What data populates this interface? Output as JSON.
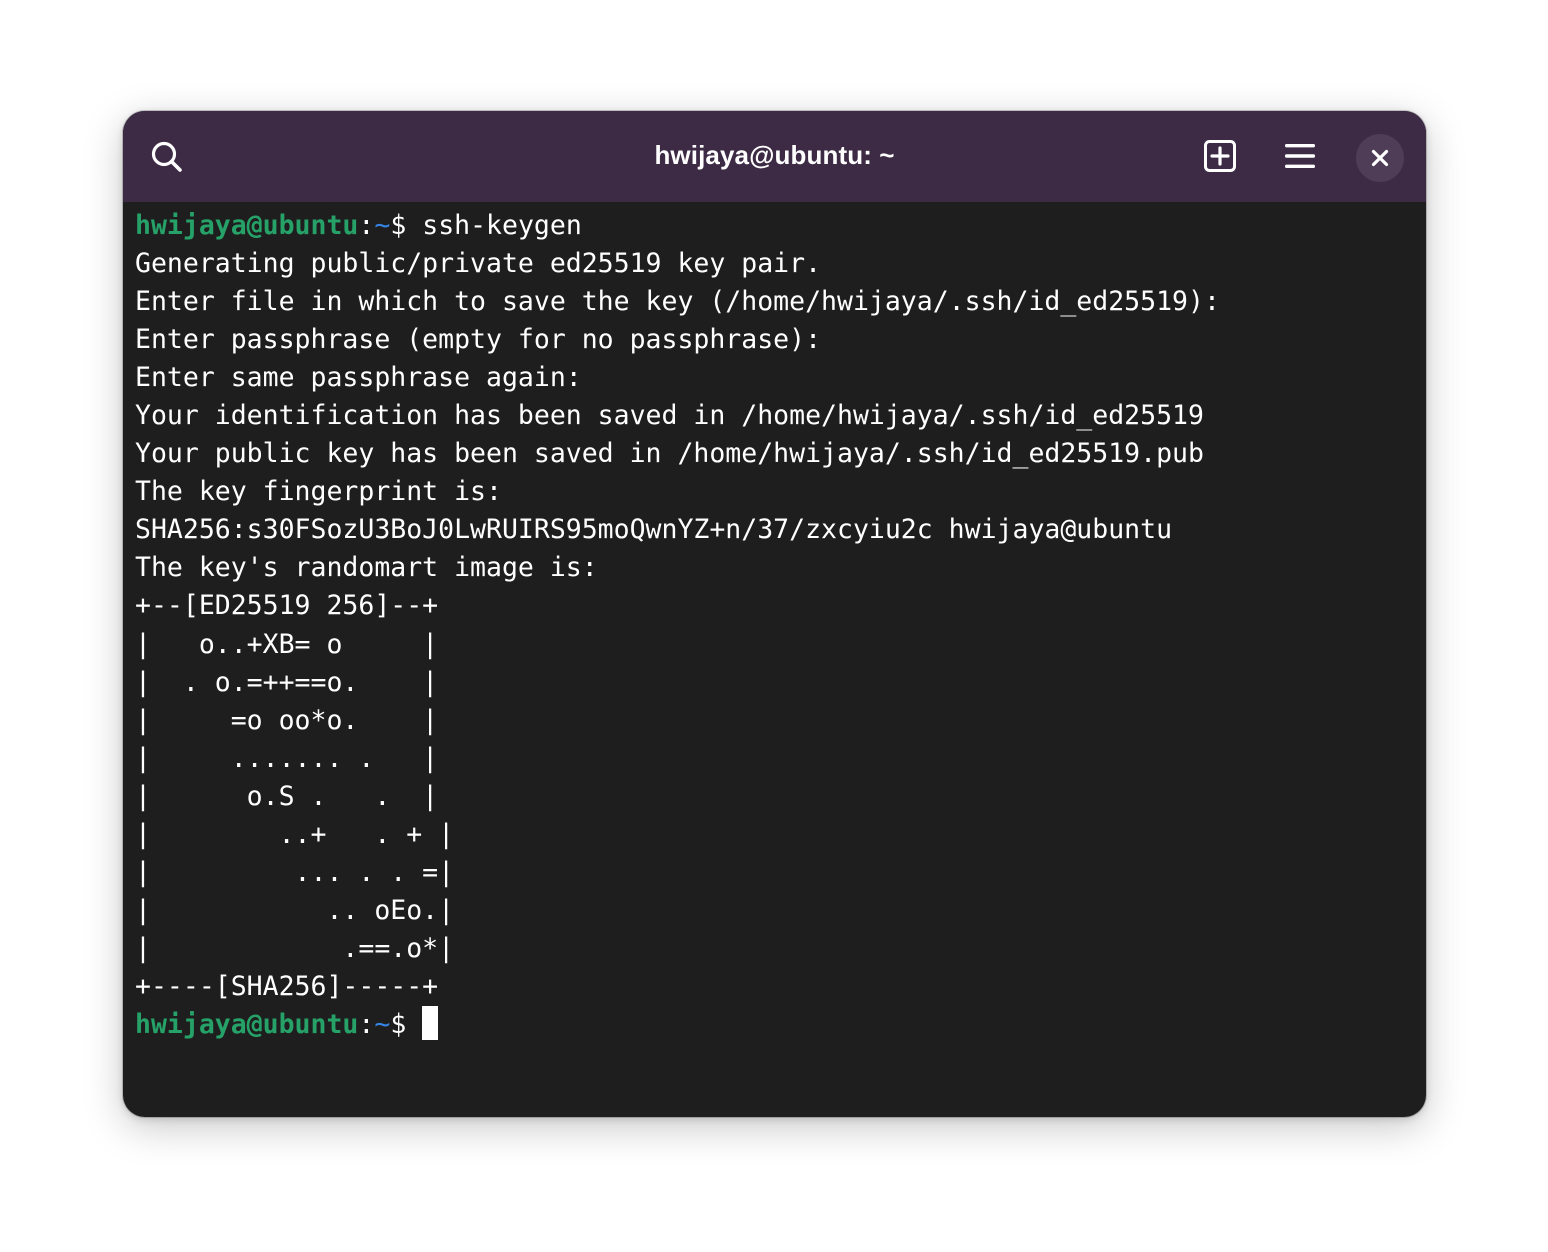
{
  "window": {
    "title": "hwijaya@ubuntu: ~"
  },
  "header": {
    "search_icon": "search-icon",
    "new_tab_icon": "new-tab-icon",
    "menu_icon": "hamburger-menu-icon",
    "close_icon": "close-icon"
  },
  "colors": {
    "header_bg": "#3d2a45",
    "terminal_bg": "#1e1e1e",
    "prompt_user": "#26a269",
    "prompt_path": "#3584e4",
    "text": "#ffffff"
  },
  "prompt": {
    "user_host": "hwijaya@ubuntu",
    "colon": ":",
    "path": "~",
    "symbol": "$ "
  },
  "terminal": {
    "command": "ssh-keygen",
    "output": [
      "Generating public/private ed25519 key pair.",
      "Enter file in which to save the key (/home/hwijaya/.ssh/id_ed25519):",
      "Enter passphrase (empty for no passphrase):",
      "Enter same passphrase again:",
      "Your identification has been saved in /home/hwijaya/.ssh/id_ed25519",
      "Your public key has been saved in /home/hwijaya/.ssh/id_ed25519.pub",
      "The key fingerprint is:",
      "SHA256:s30FSozU3BoJ0LwRUIRS95moQwnYZ+n/37/zxcyiu2c hwijaya@ubuntu",
      "The key's randomart image is:",
      "+--[ED25519 256]--+",
      "|   o..+XB= o     |",
      "|  . o.=++==o.    |",
      "|     =o oo*o.    |",
      "|     ....... .   |",
      "|      o.S .   .  |",
      "|        ..+   . + |",
      "|         ... . . =|",
      "|           .. oEo.|",
      "|            .==.o*|",
      "+----[SHA256]-----+"
    ]
  }
}
